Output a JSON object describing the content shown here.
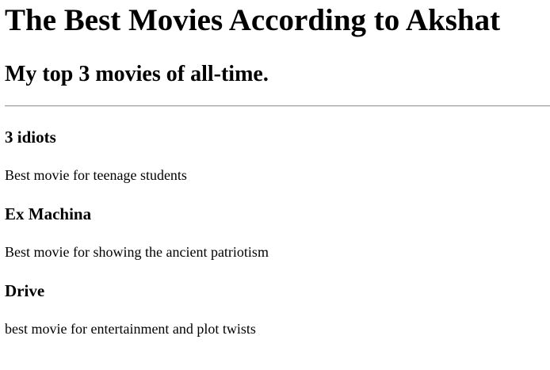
{
  "page": {
    "title": "The Best Movies According to Akshat",
    "subtitle": "My top 3 movies of all-time."
  },
  "movies": [
    {
      "title": "3 idiots",
      "description": "Best movie for teenage students"
    },
    {
      "title": "Ex Machina",
      "description": "Best movie for showing the ancient patriotism"
    },
    {
      "title": "Drive",
      "description": "best movie for entertainment and plot twists"
    }
  ]
}
